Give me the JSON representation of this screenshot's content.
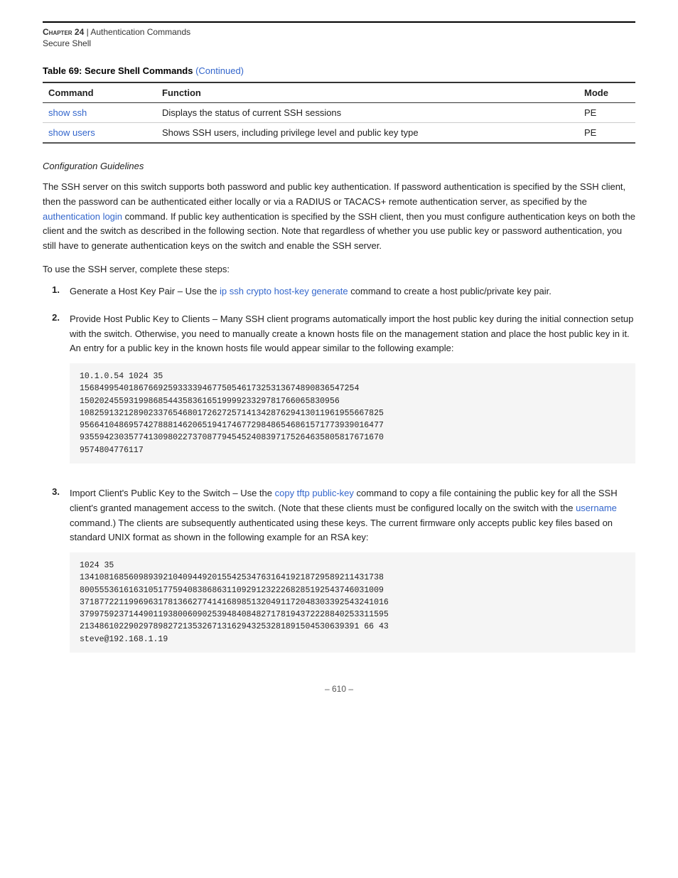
{
  "header": {
    "chapter_label": "Chapter 24",
    "separator": "  |  ",
    "chapter_title": "Authentication Commands",
    "subtitle": "Secure Shell"
  },
  "table": {
    "title": "Table 69: Secure Shell Commands",
    "continued": "(Continued)",
    "columns": [
      "Command",
      "Function",
      "Mode"
    ],
    "rows": [
      {
        "command": "show ssh",
        "command_link": true,
        "function": "Displays the status of current SSH sessions",
        "mode": "PE"
      },
      {
        "command": "show users",
        "command_link": true,
        "function": "Shows SSH users, including privilege level and public key type",
        "mode": "PE"
      }
    ]
  },
  "config_guidelines": {
    "heading": "Configuration Guidelines",
    "paragraph1": "The SSH server on this switch supports both password and public key authentication. If password authentication is specified by the SSH client, then the password can be authenticated either locally or via a RADIUS or TACACS+ remote authentication server, as specified by the authentication login command. If public key authentication is specified by the SSH client, then you must configure authentication keys on both the client and the switch as described in the following section. Note that regardless of whether you use public key or password authentication, you still have to generate authentication keys on the switch and enable the SSH server.",
    "auth_link_text": "authentication login",
    "steps_intro": "To use the SSH server, complete these steps:",
    "steps": [
      {
        "number": "1.",
        "text_before": "Generate a Host Key Pair – Use the ",
        "link_text": "ip ssh crypto host-key generate",
        "text_after": " command to create a host public/private key pair.",
        "code": "10.1.0.54 1024 35\n156849954018676692593333946775054617325313674890836547254\n150202455931998685443583616519999233297817660658309 56\n108259132128902337654680172627257141342876294130119619556678 25\n956641048695742788814620651941746772984865468615717773939016477\n935594230357741309802273708779454524083971752646358058176716 70\n9574804776117",
        "code_block": true
      },
      {
        "number": "2.",
        "text_before": "Provide Host Public Key to Clients – Many SSH client programs automatically import the host public key during the initial connection setup with the switch. Otherwise, you need to manually create a known hosts file on the management station and place the host public key in it. An entry for a public key in the known hosts file would appear similar to the following example:",
        "link_text": "",
        "text_after": "",
        "code": "10.1.0.54 1024 35\n156849954018676692593333946775054617325313674890836547254\n150202455931998685443583616519999233297817660658309 56\n108259132128902337654680172627257141342876294130119619556678 25\n956641048695742788814620651941746772984865468615717773939016477\n935594230357741309802273708779454524083971752646358058176716 70\n9574804776117",
        "code_block": true
      },
      {
        "number": "3.",
        "text_before": "Import Client's Public Key to the Switch – Use the ",
        "link_text": "copy tftp public-key",
        "text_after": " command to copy a file containing the public key for all the SSH client's granted management access to the switch. (Note that these clients must be configured locally on the switch with the username command.) The clients are subsequently authenticated using these keys. The current firmware only accepts public key files based on standard UNIX format as shown in the following example for an RSA key:",
        "username_link": "username",
        "code": "1024 35\n13410816856098939210409449201554253476316419218729589211431738\n80055536161631051775940838686311092912322268285192543746031009\n37187722119969631781366277414168985132049117204830339254324101 6\n37997592371449011938006090253948408482717819437222884025331159 5\n21348610229029789827213532671316294325328189150453063939166 43\nsteve@192.168.1.19",
        "code_block": true
      }
    ]
  },
  "footer": {
    "text": "– 610 –"
  }
}
